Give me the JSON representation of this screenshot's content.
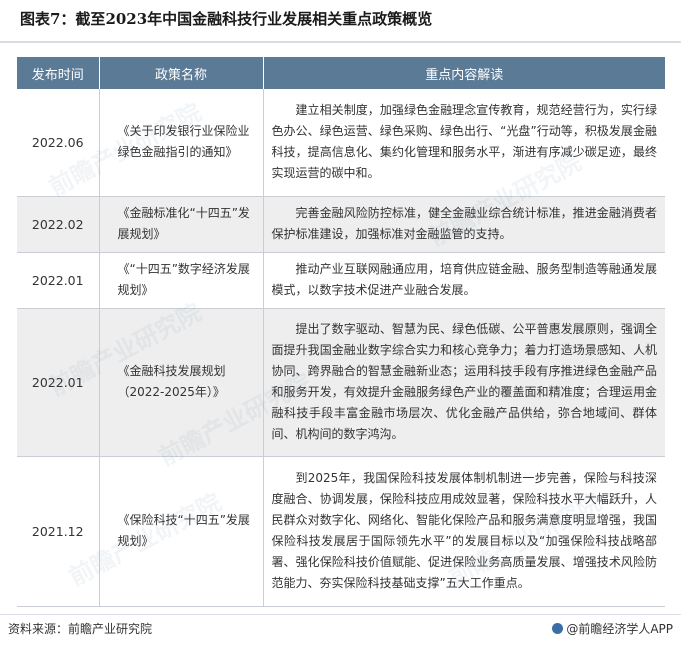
{
  "title": "图表7：截至2023年中国金融科技行业发展相关重点政策概览",
  "table": {
    "headers": [
      "发布时间",
      "政策名称",
      "重点内容解读"
    ],
    "rows": [
      {
        "date": "2022.06",
        "name": "《关于印发银行业保险业绿色金融指引的通知》",
        "content": "建立相关制度，加强绿色金融理念宣传教育，规范经营行为，实行绿色办公、绿色运营、绿色采购、绿色出行、“光盘”行动等，积极发展金融科技，提高信息化、集约化管理和服务水平，渐进有序减少碳足迹，最终实现运营的碳中和。"
      },
      {
        "date": "2022.02",
        "name": "《金融标准化“十四五”发展规划》",
        "content": "完善金融风险防控标准，健全金融业综合统计标准，推进金融消费者保护标准建设，加强标准对金融监管的支持。"
      },
      {
        "date": "2022.01",
        "name": "《“十四五”数字经济发展规划》",
        "content": "推动产业互联网融通应用，培育供应链金融、服务型制造等融通发展模式，以数字技术促进产业融合发展。"
      },
      {
        "date": "2022.01",
        "name": "《金融科技发展规划（2022-2025年）》",
        "content": "提出了数字驱动、智慧为民、绿色低碳、公平普惠发展原则，强调全面提升我国金融业数字综合实力和核心竞争力；着力打造场景感知、人机协同、跨界融合的智慧金融新业态；运用科技手段有序推进绿色金融产品和服务开发，有效提升金融服务绿色产业的覆盖面和精准度；合理运用金融科技手段丰富金融市场层次、优化金融产品供给，弥合地域间、群体间、机构间的数字鸿沟。"
      },
      {
        "date": "2021.12",
        "name": "《保险科技“十四五”发展规划》",
        "content": "到2025年，我国保险科技发展体制机制进一步完善，保险与科技深度融合、协调发展，保险科技应用成效显著，保险科技水平大幅跃升，人民群众对数字化、网络化、智能化保险产品和服务满意度明显增强，我国保险科技发展居于国际领先水平”的发展目标以及“加强保险科技战略部署、强化保险科技价值赋能、促进保险业务高质量发展、增强技术风险防范能力、夯实保险科技基础支撑”五大工作重点。"
      }
    ]
  },
  "watermark_text": "前瞻产业研究院",
  "footer": {
    "source": "资料来源：前瞻产业研究院",
    "brand": "@前瞻经济学人APP"
  }
}
